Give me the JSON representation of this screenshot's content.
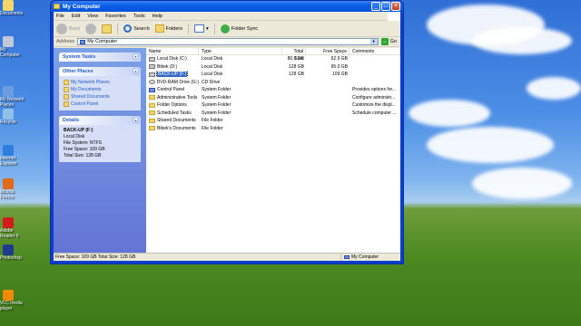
{
  "desktop": {
    "icons": [
      {
        "label": "Documents",
        "color": "#f5d66a"
      },
      {
        "label": "My Computer",
        "color": "#c0c8d8"
      },
      {
        "label": "My Network Places",
        "color": "#6d9be0"
      },
      {
        "label": "Recycle",
        "color": "#8fc0e8"
      },
      {
        "label": "Internet Explorer",
        "color": "#2f7fe0"
      },
      {
        "label": "Mozilla Firefox",
        "color": "#e06a1a"
      },
      {
        "label": "Adobe Reader 9",
        "color": "#d21d1d"
      },
      {
        "label": "Photoshop",
        "color": "#1f3b8f"
      },
      {
        "label": "VLC media player",
        "color": "#f08a00"
      }
    ]
  },
  "window": {
    "title": "My Computer",
    "controls": {
      "minimize": "_",
      "maximize": "□",
      "close": "×"
    }
  },
  "menu": [
    "File",
    "Edit",
    "View",
    "Favorites",
    "Tools",
    "Help"
  ],
  "toolbar": {
    "back": "Back",
    "search": "Search",
    "folders": "Folders",
    "folder_sync": "Folder Sync"
  },
  "address": {
    "label": "Address",
    "value": "My Computer",
    "go": "Go"
  },
  "tasks": {
    "system_tasks": "System Tasks",
    "other_places": {
      "title": "Other Places",
      "links": [
        "My Network Places",
        "My Documents",
        "Shared Documents",
        "Control Panel"
      ]
    },
    "details": {
      "title": "Details",
      "name": "BACK-UP (F:)",
      "type": "Local Disk",
      "file_system": "File System: NTFS",
      "free_space": "Free Space: 109 GB",
      "total_size": "Total Size: 128 GB"
    }
  },
  "columns": [
    "Name",
    "Type",
    "Total Size",
    "Free Space",
    "Comments"
  ],
  "items": [
    {
      "name": "Local Disk (C:)",
      "type": "Local Disk",
      "total": "80.0 GB",
      "free": "62.9 GB",
      "comment": "",
      "icon": "drive-icon"
    },
    {
      "name": "Bibek (D:)",
      "type": "Local Disk",
      "total": "128 GB",
      "free": "95.0 GB",
      "comment": "",
      "icon": "drive-icon"
    },
    {
      "name": "BACK-UP (F:)",
      "type": "Local Disk",
      "total": "128 GB",
      "free": "109 GB",
      "comment": "",
      "icon": "drive-icon",
      "selected": true
    },
    {
      "name": "DVD-RAM Drive (G:)",
      "type": "CD Drive",
      "total": "",
      "free": "",
      "comment": "",
      "icon": "cd-drive-icon"
    },
    {
      "name": "Control Panel",
      "type": "System Folder",
      "total": "",
      "free": "",
      "comment": "Provides options for...",
      "icon": "control-panel-icon"
    },
    {
      "name": "Administrative Tools",
      "type": "System Folder",
      "total": "",
      "free": "",
      "comment": "Configure administr...",
      "icon": "folder-icon"
    },
    {
      "name": "Folder Options",
      "type": "System Folder",
      "total": "",
      "free": "",
      "comment": "Customize the displ...",
      "icon": "folder-icon"
    },
    {
      "name": "Scheduled Tasks",
      "type": "System Folder",
      "total": "",
      "free": "",
      "comment": "Schedule computer ...",
      "icon": "folder-icon"
    },
    {
      "name": "Shared Documents",
      "type": "File Folder",
      "total": "",
      "free": "",
      "comment": "",
      "icon": "folder-icon"
    },
    {
      "name": "Bibek's Documents",
      "type": "File Folder",
      "total": "",
      "free": "",
      "comment": "",
      "icon": "folder-icon"
    }
  ],
  "status": {
    "left": "Free Space: 109 GB Total Size: 128 GB",
    "right": "My Computer"
  }
}
